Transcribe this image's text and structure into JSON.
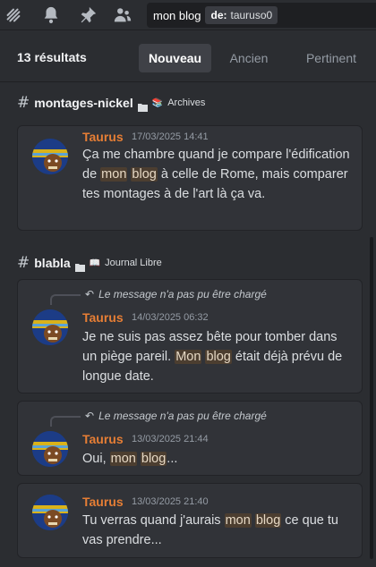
{
  "search": {
    "query": "mon blog",
    "filter_key": "de:",
    "filter_value": "tauruso0"
  },
  "header": {
    "result_count": "13 résultats",
    "tabs": [
      "Nouveau",
      "Ancien",
      "Pertinent"
    ],
    "active_tab": "Nouveau"
  },
  "groups": [
    {
      "channel": "montages-nickel",
      "category_icon": "📚",
      "category": "Archives"
    },
    {
      "channel": "blabla",
      "category_icon": "📖",
      "category": "Journal Libre"
    }
  ],
  "messages": [
    {
      "author": "Taurus",
      "timestamp": "17/03/2025 14:41",
      "parts": [
        "Ça me chambre quand je compare l'édification de ",
        "mon",
        " ",
        "blog",
        " à celle de Rome, mais comparer tes montages à de l'art là ça va."
      ]
    },
    {
      "reply_note": "Le message n'a pas pu être chargé",
      "author": "Taurus",
      "timestamp": "14/03/2025 06:32",
      "parts": [
        "Je ne suis pas assez bête pour tomber dans un piège pareil. ",
        "Mon",
        " ",
        "blog",
        " était déjà prévu de longue date."
      ]
    },
    {
      "reply_note": "Le message n'a pas pu être chargé",
      "author": "Taurus",
      "timestamp": "13/03/2025 21:44",
      "parts": [
        "Oui, ",
        "mon",
        " ",
        "blog",
        "..."
      ]
    },
    {
      "author": "Taurus",
      "timestamp": "13/03/2025 21:40",
      "parts": [
        "Tu verras quand j'aurais ",
        "mon",
        " ",
        "blog",
        " ce que tu vas prendre..."
      ]
    }
  ],
  "colors": {
    "background": "#2b2d31",
    "card": "#313338",
    "author": "#e67e35",
    "highlight": "#4c3e30"
  }
}
